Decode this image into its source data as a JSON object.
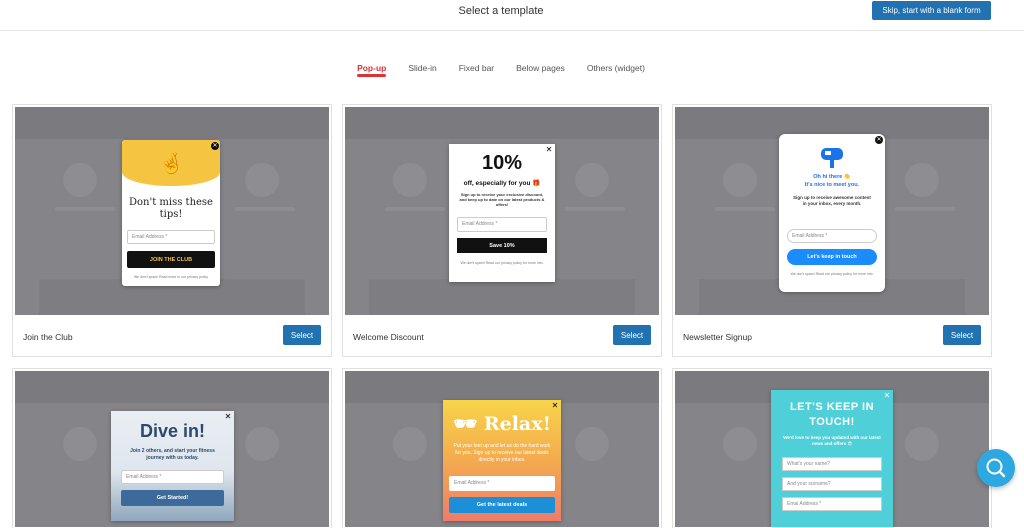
{
  "header": {
    "title": "Select a template",
    "skip_label": "Skip, start with a blank form"
  },
  "tabs": [
    {
      "label": "Pop-up",
      "active": true
    },
    {
      "label": "Slide-in",
      "active": false
    },
    {
      "label": "Fixed bar",
      "active": false
    },
    {
      "label": "Below pages",
      "active": false
    },
    {
      "label": "Others (widget)",
      "active": false
    }
  ],
  "select_label": "Select",
  "cards": [
    {
      "name": "Join the Club",
      "popup": {
        "heading": "Don't miss these tips!",
        "email_placeholder": "Email Address *",
        "button": "JOIN THE CLUB",
        "disclaimer": "We don't spam! Read more in our privacy policy"
      }
    },
    {
      "name": "Welcome Discount",
      "popup": {
        "big": "10%",
        "heading": "off, especially for you 🎁",
        "text": "Sign up to receive your exclusive discount, and keep up to date on our latest products & offers!",
        "email_placeholder": "Email Address *",
        "button": "Save 10%",
        "disclaimer": "We don't spam! Read our privacy policy for more info."
      }
    },
    {
      "name": "Newsletter Signup",
      "popup": {
        "heading1": "Oh hi there 👋",
        "heading2": "It's nice to meet you.",
        "text": "Sign up to receive awesome content in your inbox, every month.",
        "email_placeholder": "Email Address *",
        "button": "Let's keep in touch",
        "disclaimer": "We don't spam! Read our privacy policy for more info."
      }
    },
    {
      "name": "",
      "popup": {
        "heading": "Dive in!",
        "text": "Join 2 others, and start your fitness journey with us today.",
        "email_placeholder": "Email Address *",
        "button": "Get Started!"
      }
    },
    {
      "name": "",
      "popup": {
        "heading": "🕶 Relax!",
        "text": "Put your feet up and let us do the hard work for you. Sign up to receive our latest deals directly in your inbox.",
        "email_placeholder": "Email Address *",
        "button": "Get the latest deals"
      }
    },
    {
      "name": "",
      "popup": {
        "heading": "LET'S KEEP IN TOUCH!",
        "text": "We'd love to keep you updated with our latest news and offers 😎",
        "field1": "What's your name?",
        "field2": "And your surname?",
        "field3": "Emai Address *"
      }
    }
  ],
  "colors": {
    "accent": "#d63638",
    "button_blue": "#2271b1",
    "overlay": "#858589"
  }
}
